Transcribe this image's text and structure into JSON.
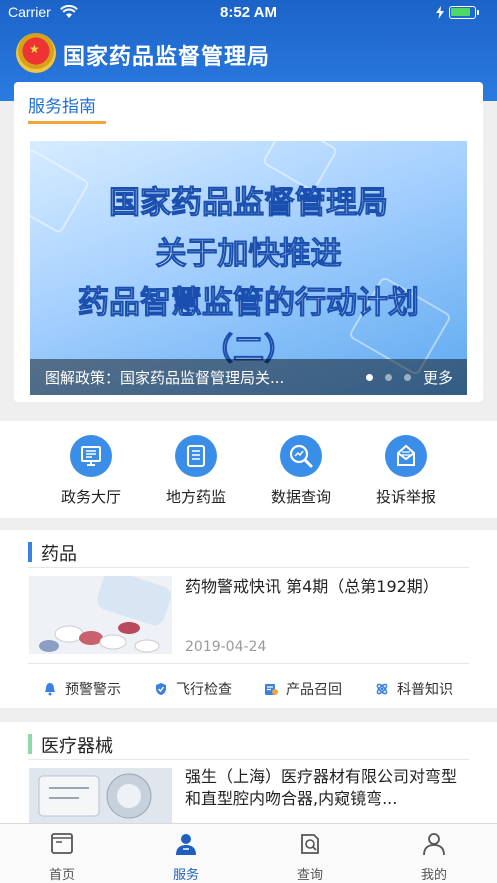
{
  "status_bar": {
    "carrier": "Carrier",
    "time": "8:52 AM",
    "battery_level": 0.85,
    "charging": true
  },
  "app": {
    "title": "国家药品监督管理局"
  },
  "service_tab": {
    "label": "服务指南"
  },
  "banner": {
    "lines": [
      "国家药品监督管理局",
      "关于加快推进",
      "药品智慧监管的行动计划",
      "（二）"
    ],
    "caption": "图解政策：国家药品监督管理局关...",
    "page_count": 3,
    "active_page": 1,
    "more_label": "更多"
  },
  "quick_actions": [
    {
      "label": "政务大厅",
      "icon": "government-hall-icon"
    },
    {
      "label": "地方药监",
      "icon": "local-regulator-icon"
    },
    {
      "label": "数据查询",
      "icon": "data-search-icon"
    },
    {
      "label": "投诉举报",
      "icon": "complaint-mail-icon"
    }
  ],
  "drug_section": {
    "title": "药品",
    "accent_color": "#3b82e0",
    "article": {
      "title": "药物警戒快讯 第4期（总第192期）",
      "date": "2019-04-24"
    },
    "categories": [
      {
        "label": "预警警示",
        "icon": "alarm-bell-icon"
      },
      {
        "label": "飞行检查",
        "icon": "shield-check-icon"
      },
      {
        "label": "产品召回",
        "icon": "recall-document-icon"
      },
      {
        "label": "科普知识",
        "icon": "atom-knowledge-icon"
      }
    ]
  },
  "device_section": {
    "title": "医疗器械",
    "accent_color": "#8fd9a8",
    "article": {
      "title": "强生（上海）医疗器材有限公司对弯型和直型腔内吻合器,内窥镜弯..."
    }
  },
  "tab_bar": {
    "items": [
      {
        "label": "首页",
        "icon": "home-book-icon",
        "active": false
      },
      {
        "label": "服务",
        "icon": "service-person-icon",
        "active": true
      },
      {
        "label": "查询",
        "icon": "query-search-icon",
        "active": false
      },
      {
        "label": "我的",
        "icon": "profile-icon",
        "active": false
      }
    ]
  },
  "colors": {
    "header_blue": "#1f6fd1",
    "accent_orange": "#f0a43a",
    "icon_blue": "#3b8ee8"
  }
}
